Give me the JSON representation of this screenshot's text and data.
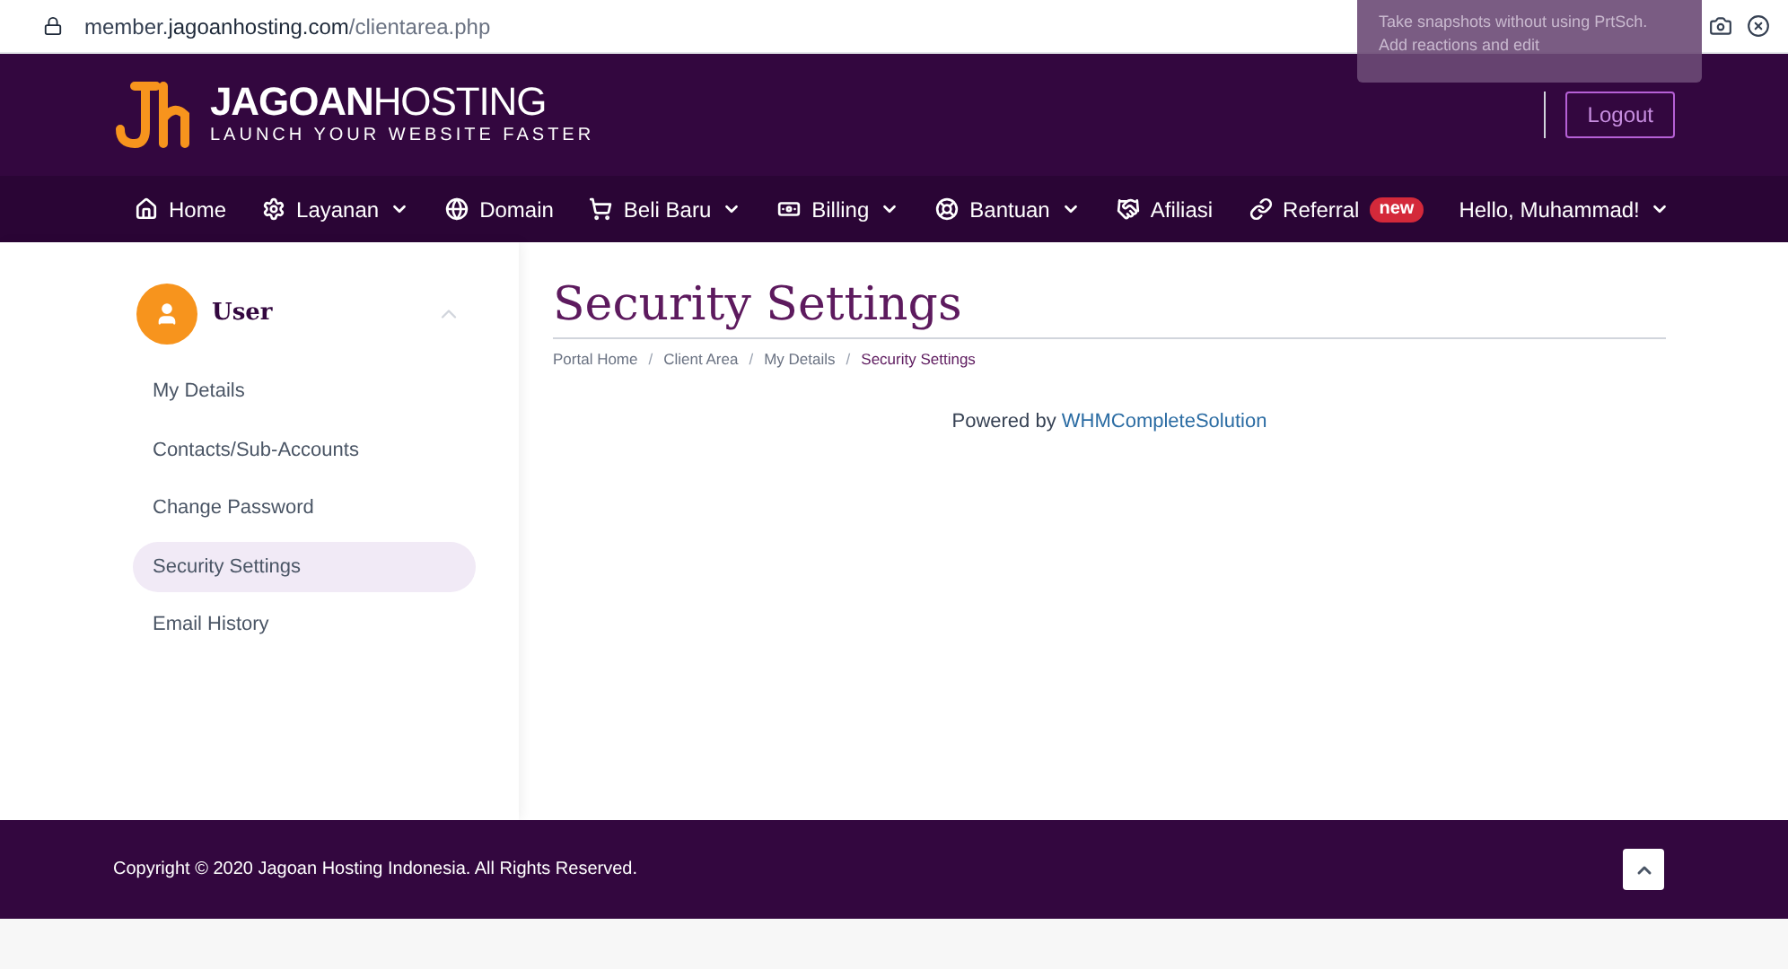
{
  "browser": {
    "url_host": "member.",
    "url_domain": "jagoanhosting.com",
    "url_path": "/clientarea.php"
  },
  "popup": {
    "line_1": "Take snapshots without using PrtSch.",
    "line_2": "Add reactions and edit"
  },
  "header": {
    "logo_bold": "JAGOAN",
    "logo_light": "HOSTING",
    "tagline": "LAUNCH YOUR WEBSITE FASTER",
    "logout": "Logout"
  },
  "nav": [
    {
      "label": "Home",
      "dropdown": false
    },
    {
      "label": "Layanan",
      "dropdown": true
    },
    {
      "label": "Domain",
      "dropdown": false
    },
    {
      "label": "Beli Baru",
      "dropdown": true
    },
    {
      "label": "Billing",
      "dropdown": true
    },
    {
      "label": "Bantuan",
      "dropdown": true
    },
    {
      "label": "Afiliasi",
      "dropdown": false
    },
    {
      "label": "Referral",
      "dropdown": false,
      "badge": "new"
    },
    {
      "label": "Hello, Muhammad!",
      "dropdown": true
    }
  ],
  "sidebar": {
    "title": "User",
    "expanded": true,
    "items": [
      {
        "label": "My Details",
        "selected": false
      },
      {
        "label": "Contacts/Sub-Accounts",
        "selected": false
      },
      {
        "label": "Change Password",
        "selected": false
      },
      {
        "label": "Security Settings",
        "selected": true
      },
      {
        "label": "Email History",
        "selected": false
      }
    ]
  },
  "page": {
    "title": "Security Settings",
    "breadcrumb": [
      {
        "label": "Portal Home",
        "current": false
      },
      {
        "label": "Client Area",
        "current": false
      },
      {
        "label": "My Details",
        "current": false
      },
      {
        "label": "Security Settings",
        "current": true
      }
    ],
    "separator": "/",
    "powered_prefix": "Powered by ",
    "powered_link": "WHMCompleteSolution"
  },
  "footer": {
    "copyright": "Copyright © 2020 Jagoan Hosting Indonesia. All Rights Reserved."
  }
}
